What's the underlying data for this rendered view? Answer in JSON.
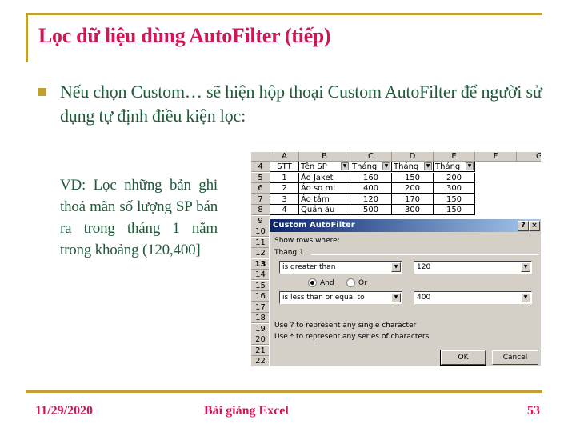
{
  "slide": {
    "title": "Lọc dữ liệu dùng AutoFilter (tiếp)",
    "bullet_text": "Nếu chọn Custom… sẽ hiện hộp thoại Custom AutoFilter để người sử dụng tự định điều kiện lọc:",
    "example_text": "VD: Lọc những bản ghi thoả mãn số lượng SP bán ra trong tháng 1 nằm trong khoảng (120,400]",
    "colors": {
      "title": "#d4145a",
      "body": "#1f5a3a",
      "accent": "#c0a030"
    }
  },
  "spreadsheet": {
    "columns": [
      "A",
      "B",
      "C",
      "D",
      "E",
      "F",
      "G"
    ],
    "rows": [
      "4",
      "5",
      "6",
      "7",
      "8",
      "9",
      "10",
      "11",
      "12",
      "13",
      "14",
      "15",
      "16",
      "17",
      "18",
      "19",
      "20",
      "21",
      "22"
    ],
    "active_row": "13",
    "header_row": [
      "STT",
      "Tên SP",
      "Tháng",
      "Tháng",
      "Tháng"
    ],
    "data": [
      [
        "1",
        "Áo Jaket",
        "160",
        "150",
        "200"
      ],
      [
        "2",
        "Áo sơ mi",
        "400",
        "200",
        "300"
      ],
      [
        "3",
        "Áo tắm",
        "120",
        "170",
        "150"
      ],
      [
        "4",
        "Quần âu",
        "500",
        "300",
        "150"
      ]
    ]
  },
  "dialog": {
    "title": "Custom AutoFilter",
    "help_button": "?",
    "close_button": "×",
    "show_rows_label": "Show rows where:",
    "field_label": "Tháng 1",
    "condition1": {
      "operator": "is greater than",
      "value": "120"
    },
    "condition2": {
      "operator": "is less than or equal to",
      "value": "400"
    },
    "logic_and": "And",
    "logic_or": "Or",
    "logic_selected": "And",
    "hint1": "Use ? to represent any single character",
    "hint2": "Use * to represent any series of characters",
    "ok_label": "OK",
    "cancel_label": "Cancel"
  },
  "footer": {
    "date": "11/29/2020",
    "center": "Bài giảng Excel",
    "page": "53"
  }
}
